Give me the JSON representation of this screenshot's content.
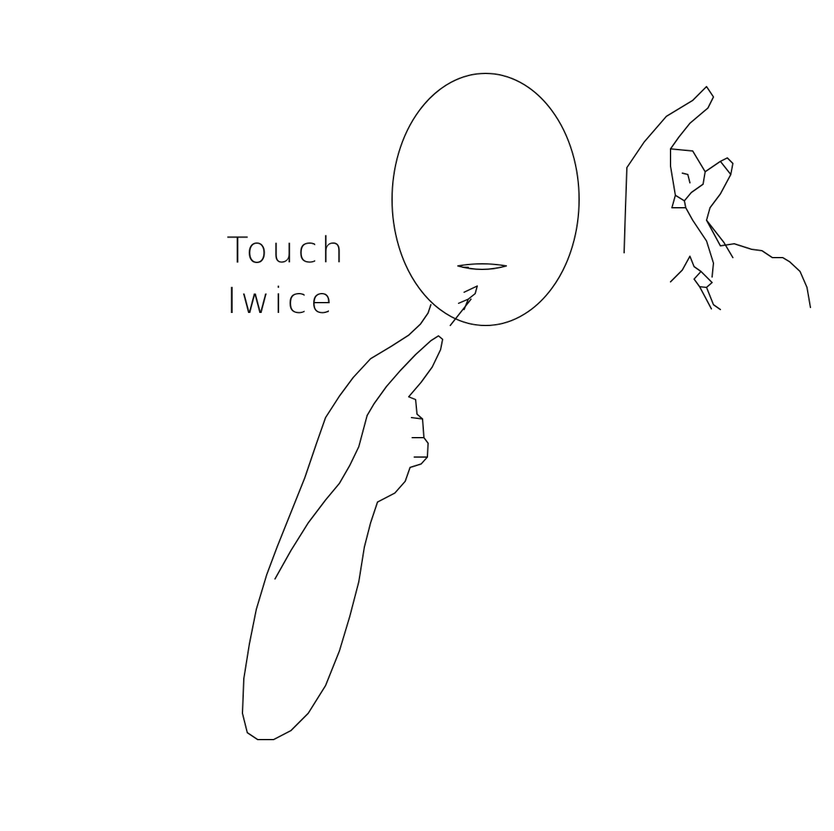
{
  "caption": {
    "line1": "Touch",
    "line2": "Iwice"
  },
  "colors": {
    "background": "#ffffff",
    "ink": "#111111"
  }
}
